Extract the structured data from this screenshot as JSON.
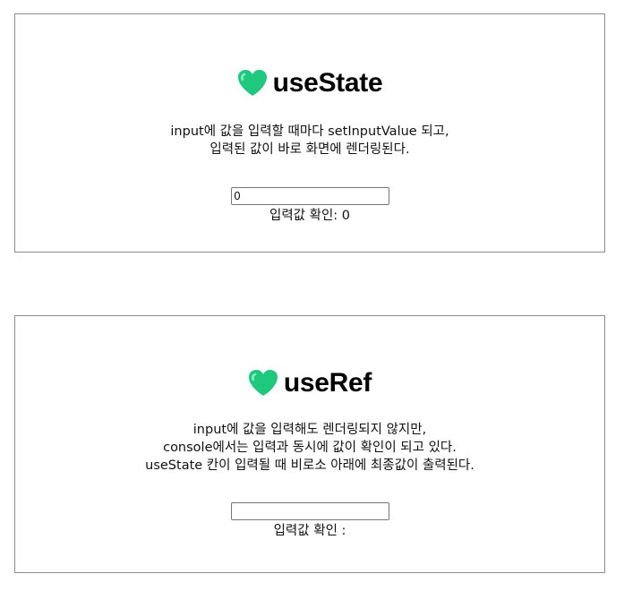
{
  "use_state_section": {
    "title": "useState",
    "heart_icon": "green-heart-icon",
    "desc_line1": "input에 값을 입력할 때마다 setInputValue 되고,",
    "desc_line2": "입력된 값이 바로 화면에 렌더링된다.",
    "input_value": "0",
    "confirm_label": "입력값 확인: 0"
  },
  "use_ref_section": {
    "title": "useRef",
    "heart_icon": "green-heart-icon",
    "desc_line1": "input에 값을 입력해도 렌더링되지 않지만,",
    "desc_line2": "console에서는 입력과 동시에 값이 확인이 되고 있다.",
    "desc_line3": "useState 칸이 입력될 때 비로소 아래에 최종값이 출력된다.",
    "input_value": "",
    "confirm_label": "입력값 확인 :"
  },
  "colors": {
    "heart": "#1ec97e",
    "border": "#8c8c8c"
  }
}
